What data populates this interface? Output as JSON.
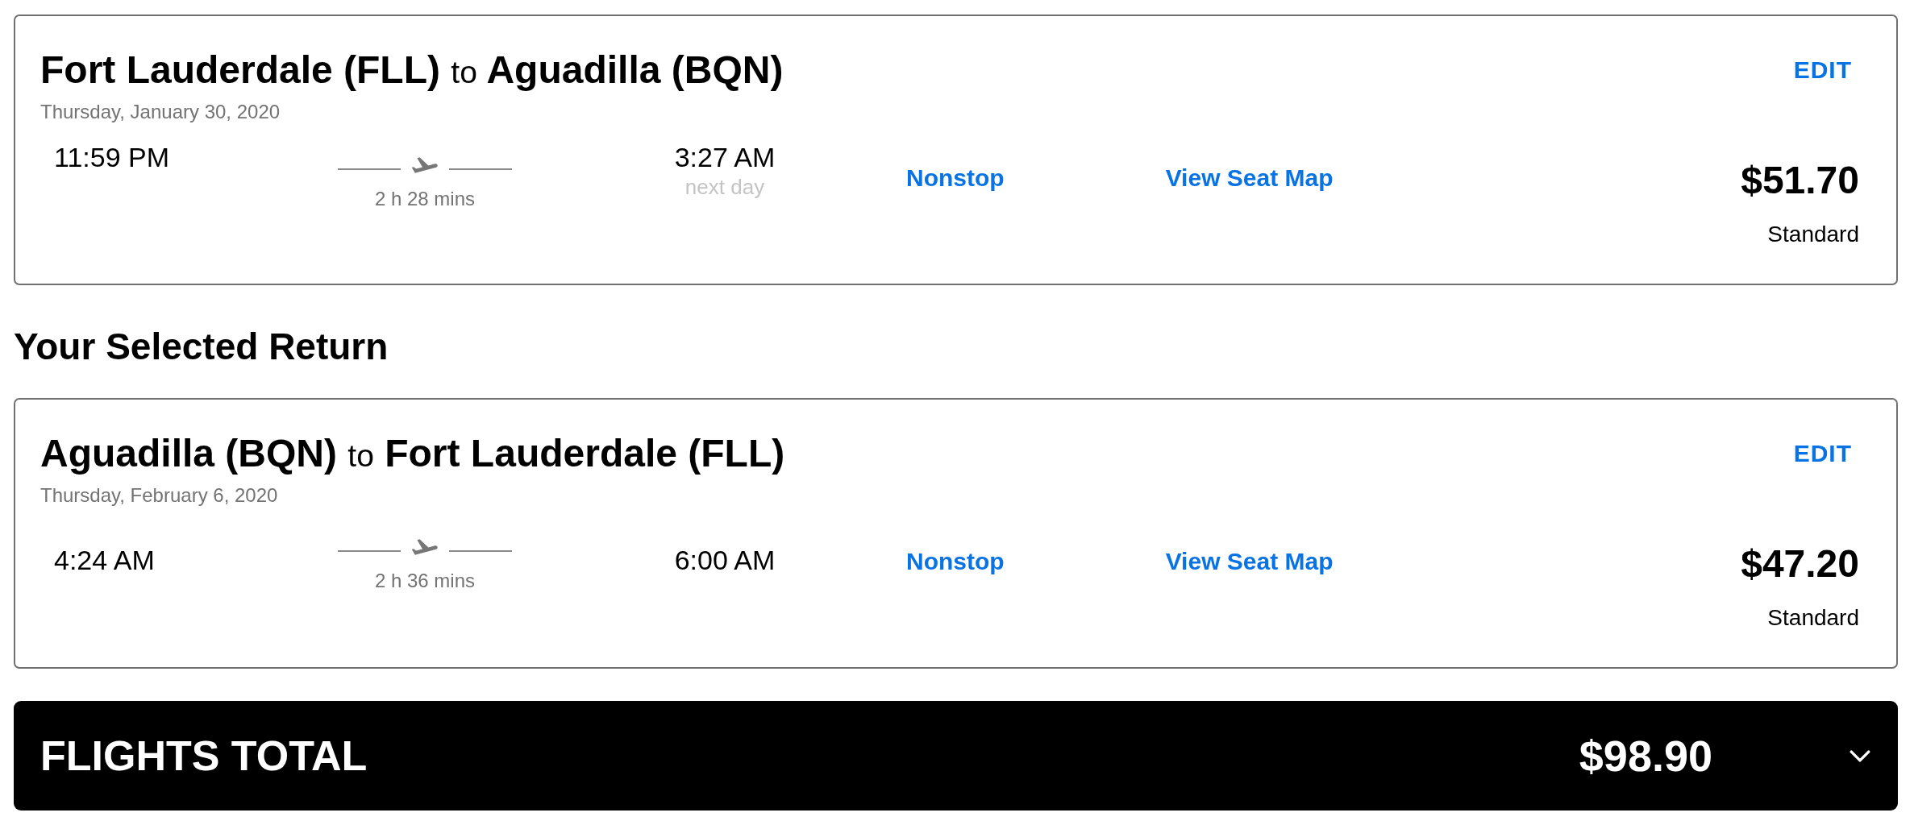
{
  "flights": [
    {
      "origin": "Fort Lauderdale (FLL)",
      "connector": "to",
      "destination": "Aguadilla (BQN)",
      "date": "Thursday, January 30, 2020",
      "edit": "EDIT",
      "depart": "11:59 PM",
      "duration": "2 h 28 mins",
      "arrive": "3:27 AM",
      "arrival_note": "next day",
      "stops": "Nonstop",
      "seat_map": "View Seat Map",
      "price": "$51.70",
      "fare": "Standard"
    },
    {
      "heading": "Your Selected Return",
      "origin": "Aguadilla (BQN)",
      "connector": "to",
      "destination": "Fort Lauderdale (FLL)",
      "date": "Thursday, February 6, 2020",
      "edit": "EDIT",
      "depart": "4:24 AM",
      "duration": "2 h 36 mins",
      "arrive": "6:00 AM",
      "stops": "Nonstop",
      "seat_map": "View Seat Map",
      "price": "$47.20",
      "fare": "Standard"
    }
  ],
  "total": {
    "label": "FLIGHTS TOTAL",
    "amount": "$98.90",
    "expanded": false
  }
}
